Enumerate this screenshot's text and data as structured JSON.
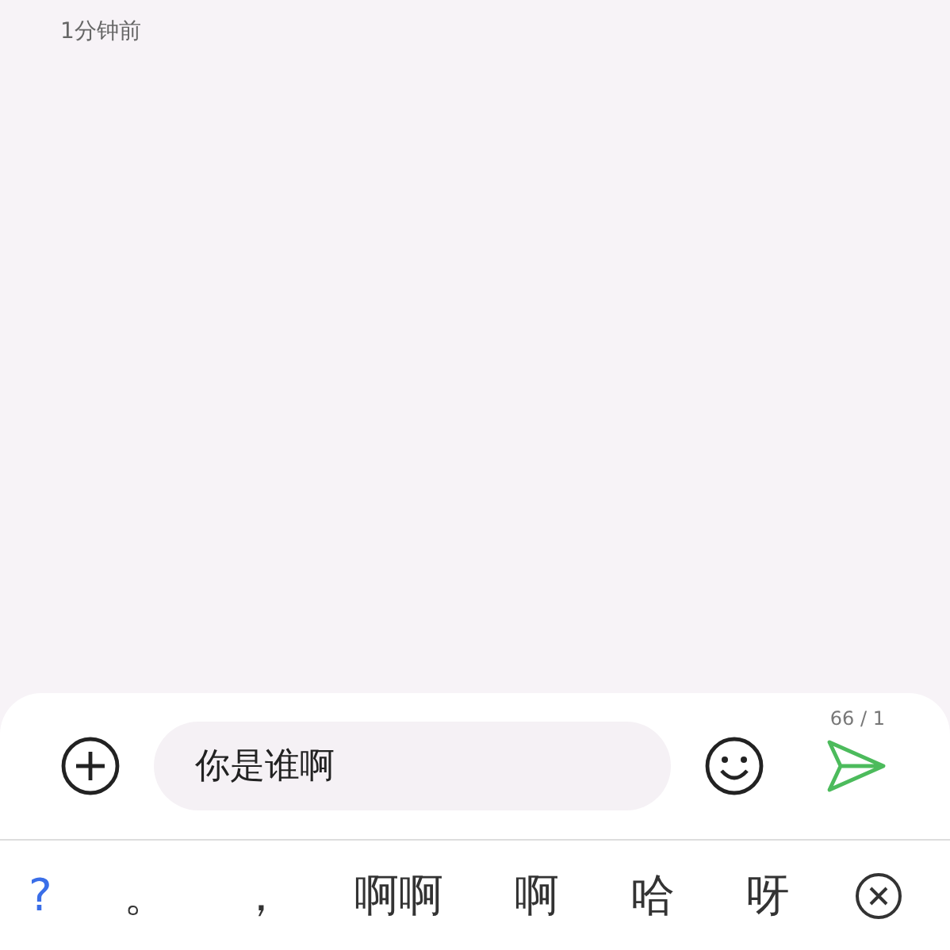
{
  "timestamp": "1分钟前",
  "composer": {
    "value": "你是谁啊",
    "counter": "66 / 1"
  },
  "candidates": [
    {
      "label": "?",
      "selected": true
    },
    {
      "label": "。",
      "selected": false
    },
    {
      "label": "，",
      "selected": false
    },
    {
      "label": "啊啊",
      "selected": false
    },
    {
      "label": "啊",
      "selected": false
    },
    {
      "label": "哈",
      "selected": false
    },
    {
      "label": "呀",
      "selected": false
    }
  ]
}
